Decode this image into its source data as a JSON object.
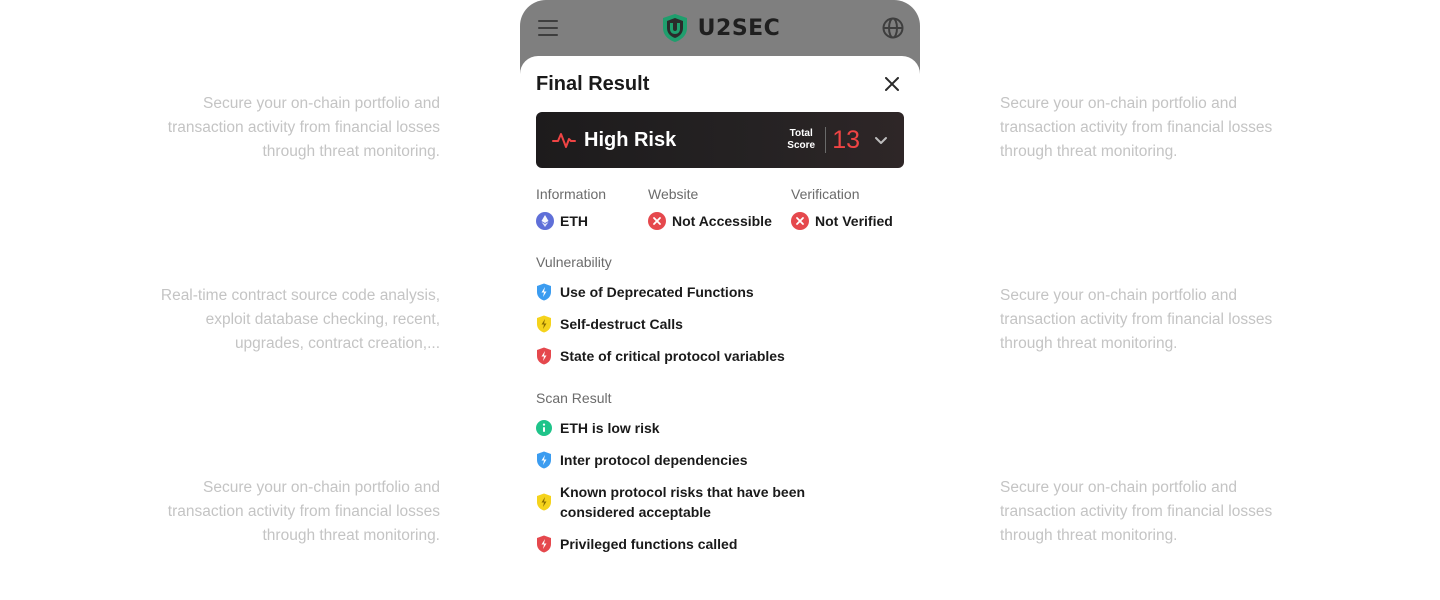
{
  "side_texts": {
    "left_top": "Secure your on-chain portfolio and transaction activity from financial losses through threat monitoring.",
    "left_middle": "Real-time contract source code analysis, exploit database checking, recent, upgrades, contract creation,...",
    "left_bottom": "Secure your on-chain portfolio and transaction activity from financial losses through threat monitoring.",
    "right_top": "Secure your on-chain portfolio and transaction activity from financial losses through threat monitoring.",
    "right_middle": "Secure your on-chain portfolio and transaction activity from financial losses through threat monitoring.",
    "right_bottom": "Secure your on-chain portfolio and transaction activity from financial losses through threat monitoring."
  },
  "header": {
    "brand": "U2SEC",
    "menu_icon": "hamburger-icon",
    "globe_icon": "globe-icon"
  },
  "sheet": {
    "title": "Final Result",
    "risk": {
      "label": "High Risk",
      "score_label_line1": "Total",
      "score_label_line2": "Score",
      "score": "13"
    },
    "info": {
      "information_label": "Information",
      "information_value": "ETH",
      "website_label": "Website",
      "website_value": "Not Accessible",
      "verification_label": "Verification",
      "verification_value": "Not Verified"
    },
    "vulnerability": {
      "label": "Vulnerability",
      "items": [
        {
          "text": "Use of Deprecated Functions",
          "level": "blue"
        },
        {
          "text": "Self-destruct Calls",
          "level": "yellow"
        },
        {
          "text": "State of critical protocol variables",
          "level": "red"
        }
      ]
    },
    "scan": {
      "label": "Scan Result",
      "items": [
        {
          "text": "ETH is low risk",
          "level": "green"
        },
        {
          "text": "Inter protocol dependencies",
          "level": "blue"
        },
        {
          "text": "Known protocol risks that have been considered acceptable",
          "level": "yellow"
        },
        {
          "text": "Privileged functions called",
          "level": "red"
        }
      ]
    }
  },
  "colors": {
    "blue": "#3b9cf0",
    "yellow": "#f5d31c",
    "red": "#e5484d",
    "green": "#1fc48a",
    "logo_green": "#1f9e6d",
    "score_red": "#ef4444"
  }
}
